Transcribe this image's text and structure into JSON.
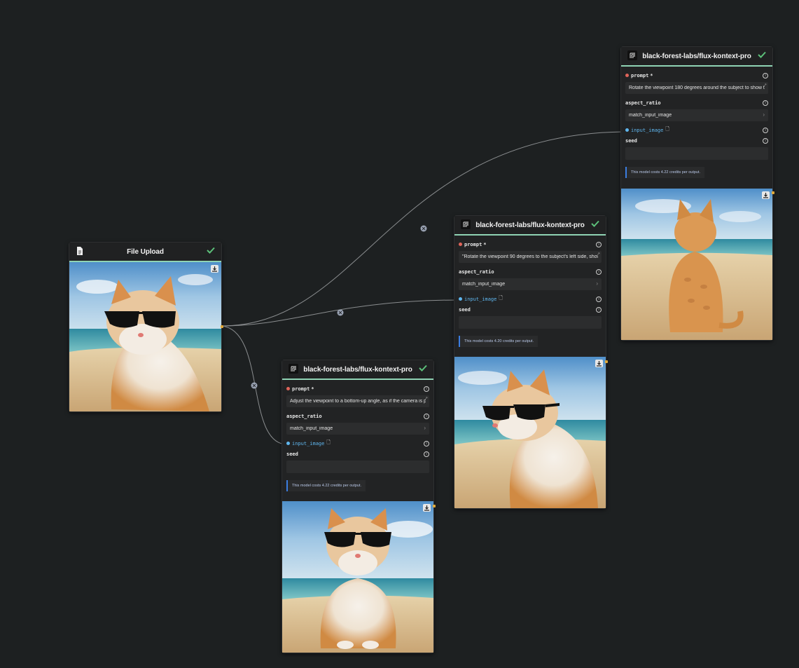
{
  "colors": {
    "background": "#1d2021",
    "accent": "#8fd3b4",
    "edge": "#8a8d8f",
    "port": "#e0a93a",
    "link": "#5fb6ee"
  },
  "upload_node": {
    "title": "File Upload",
    "icon": "file-icon",
    "status_icon": "check-icon"
  },
  "node_common": {
    "title": "black-forest-labs/flux-kontext-pro",
    "prompt_label": "prompt",
    "prompt_required": "*",
    "aspect_ratio_label": "aspect_ratio",
    "aspect_ratio_value": "match_input_image",
    "input_image_label": "input_image",
    "seed_label": "seed",
    "cost_text_422": "This model costs 4.22 credits per output.",
    "cost_text_420": "This model costs 4.20 credits per output."
  },
  "nodes": [
    {
      "id": "node-bottom",
      "prompt_value": "Adjust the viewpoint to a bottom-up angle, as if the camera is p"
    },
    {
      "id": "node-middle",
      "prompt_value": "\"Rotate the viewpoint 90 degrees to the subject's left side, show"
    },
    {
      "id": "node-top",
      "prompt_value": "Rotate the viewpoint 180 degrees around the subject to show th"
    }
  ]
}
